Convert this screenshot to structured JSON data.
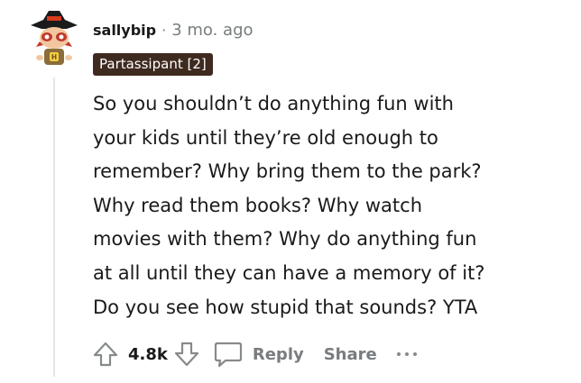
{
  "comment": {
    "author": "sallybip",
    "separator": "·",
    "timestamp": "3 mo. ago",
    "flair": "Partassipant [2]",
    "avatar_icon": "snoo-avatar-hat-icon",
    "body_lines": [
      "So you shouldn’t do anything fun with",
      "your kids until they’re old enough to",
      "remember? Why bring them to the park?",
      "Why read them books? Why watch",
      "movies with them? Why do anything fun",
      "at all until they can have a memory of it?",
      "Do you see how stupid that sounds? YTA"
    ]
  },
  "actions": {
    "upvote_icon": "upvote-arrow-icon",
    "score": "4.8k",
    "downvote_icon": "downvote-arrow-icon",
    "reply_icon": "speech-bubble-icon",
    "reply_label": "Reply",
    "share_label": "Share",
    "more_icon": "more-dots-icon"
  },
  "colors": {
    "text_primary": "#1a1a1b",
    "text_muted": "#787c7e",
    "flair_bg": "#3f2a20",
    "thread_line": "#e3e5e8"
  }
}
